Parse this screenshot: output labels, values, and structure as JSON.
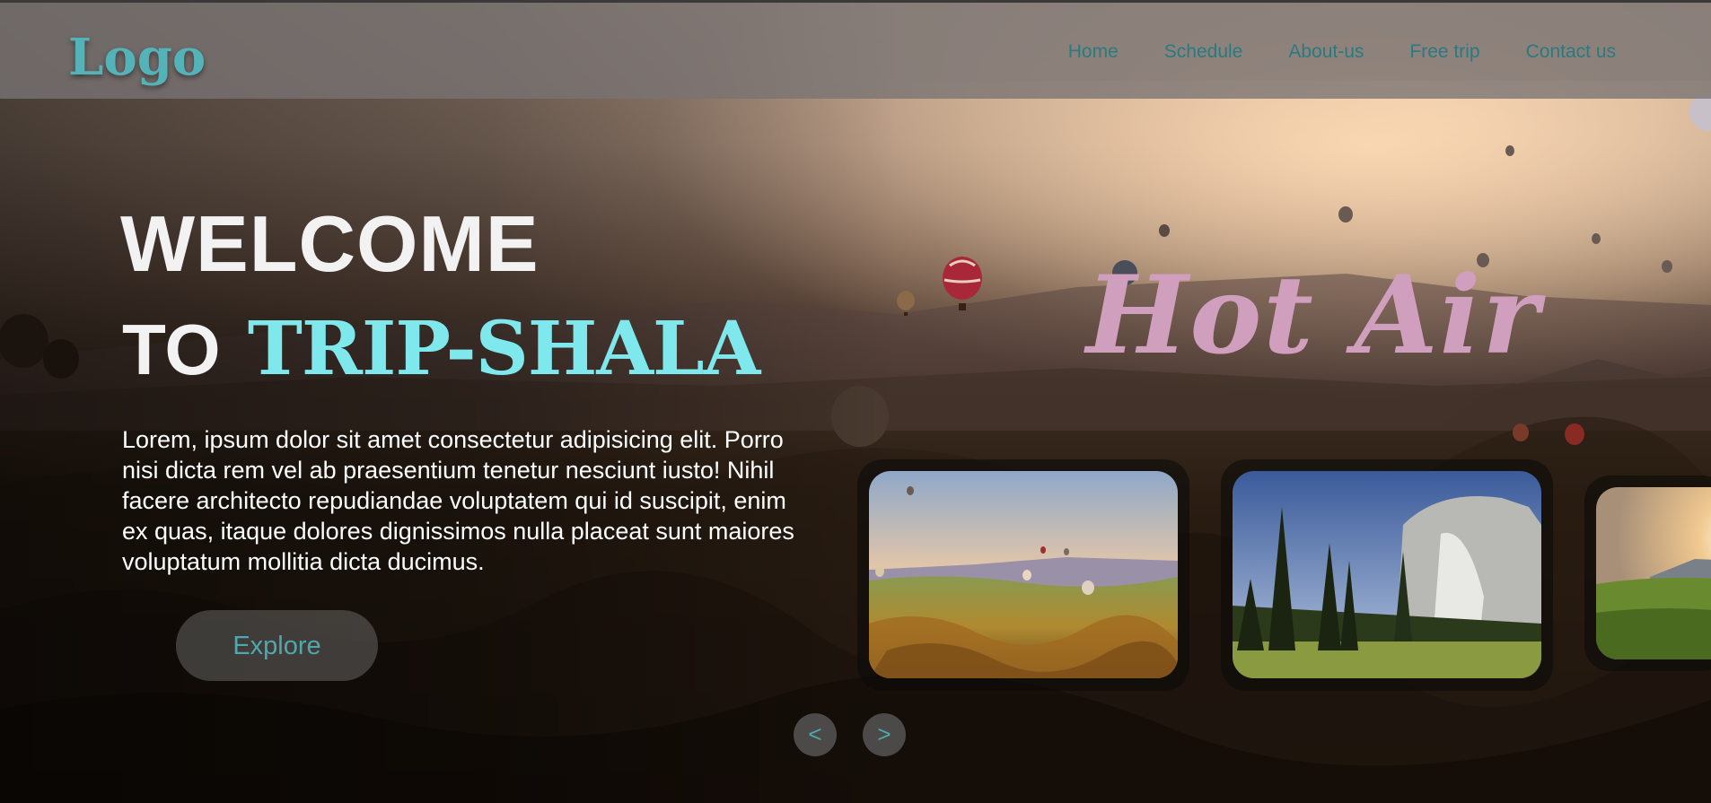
{
  "header": {
    "logo": "Logo",
    "nav": [
      {
        "label": "Home"
      },
      {
        "label": "Schedule"
      },
      {
        "label": "About-us"
      },
      {
        "label": "Free trip"
      },
      {
        "label": "Contact us"
      }
    ]
  },
  "hero": {
    "line1": "WELCOME",
    "line2_prefix": "TO",
    "brand": "TRIP-SHALA",
    "description": "Lorem, ipsum dolor sit amet consectetur adipisicing elit. Porro nisi dicta rem vel ab praesentium tenetur nesciunt iusto! Nihil facere architecto repudiandae voluptatem qui id suscipit, enim ex quas, itaque dolores dignissimos nulla placeat sunt maiores voluptatum mollitia dicta ducimus.",
    "explore_label": "Explore",
    "tagline": "Hot Air"
  },
  "carousel": {
    "cards": [
      {
        "image": "hot-air-balloons-valley-photo"
      },
      {
        "image": "granite-cliff-pine-forest-photo"
      },
      {
        "image": "sunset-meadow-photo"
      }
    ],
    "prev_label": "<",
    "next_label": ">"
  },
  "colors": {
    "accent_cyan": "#7fe8ec",
    "nav_teal": "#2a7a80",
    "logo_teal": "#54b3b8",
    "tagline_pink": "#d19fbe"
  }
}
